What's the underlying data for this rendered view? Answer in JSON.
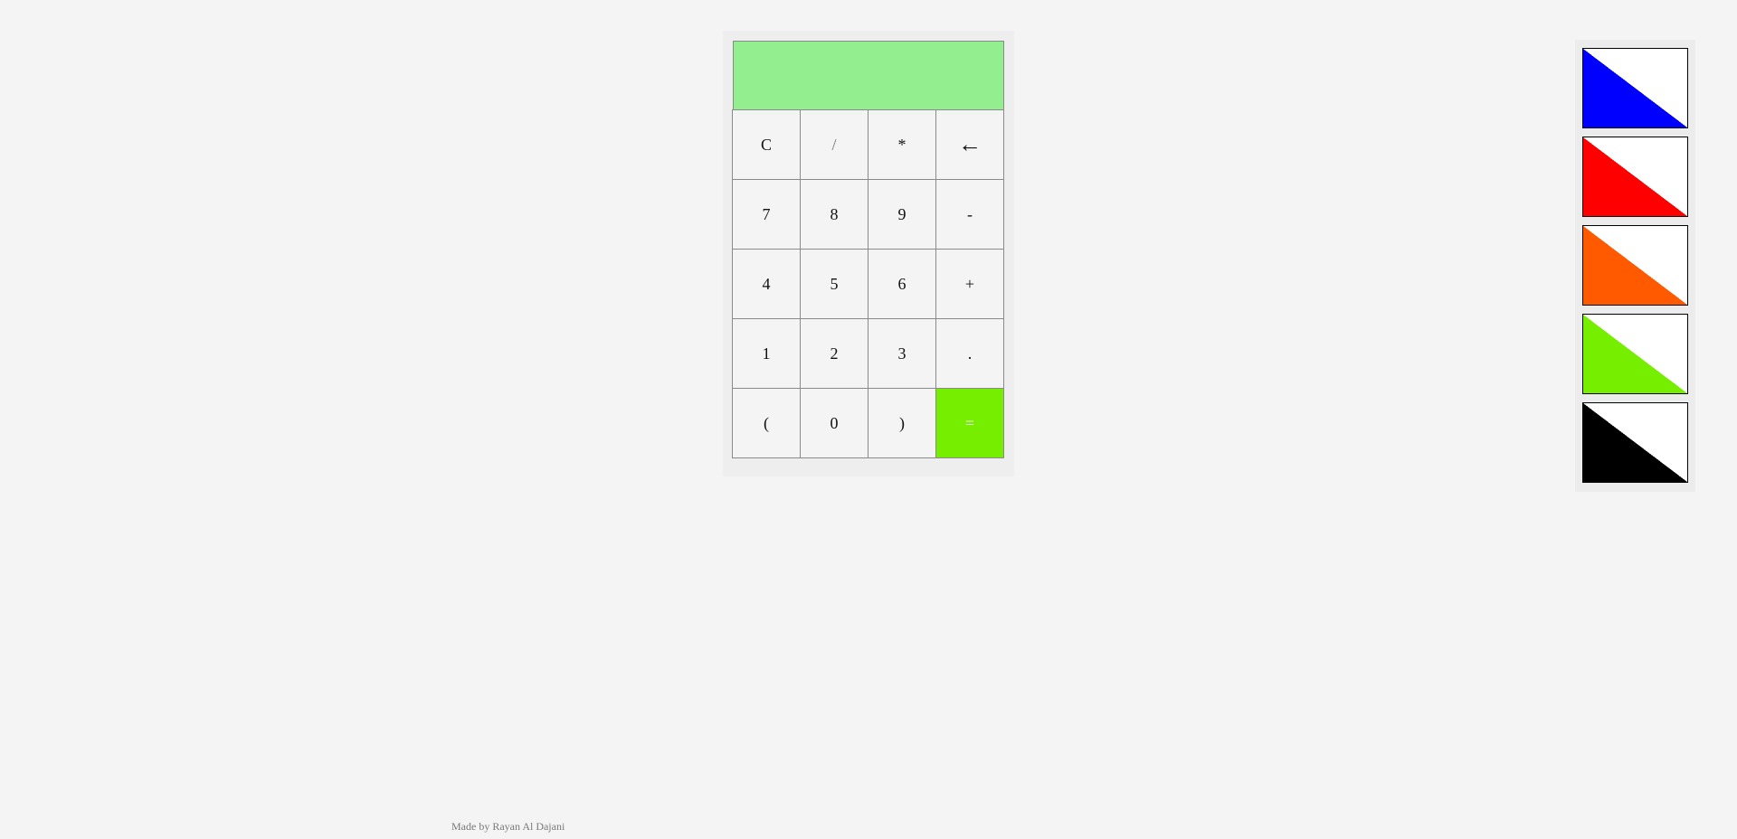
{
  "display": {
    "value": ""
  },
  "keypad": {
    "keys": [
      "C",
      "/",
      "*",
      "←",
      "7",
      "8",
      "9",
      "-",
      "4",
      "5",
      "6",
      "+",
      "1",
      "2",
      "3",
      ".",
      "(",
      "0",
      ")",
      "="
    ]
  },
  "themes": {
    "items": [
      {
        "name": "blue",
        "color": "#0000ff"
      },
      {
        "name": "red",
        "color": "#ff0000"
      },
      {
        "name": "orange",
        "color": "#ff5a00"
      },
      {
        "name": "green",
        "color": "#76ee00"
      },
      {
        "name": "black",
        "color": "#000000"
      }
    ]
  },
  "colors": {
    "display_background": "#92ee8f",
    "equals_background": "#76ee00",
    "page_background": "#f4f4f4"
  },
  "footer": {
    "credit": "Made by Rayan Al Dajani"
  }
}
